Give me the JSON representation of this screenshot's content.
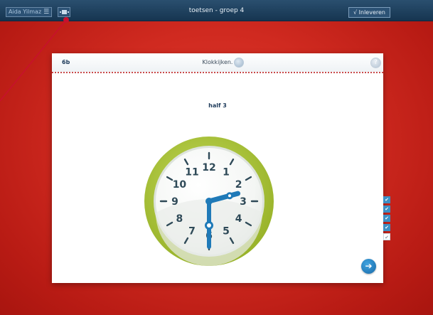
{
  "topbar": {
    "user_name": "Aida Yilmaz",
    "menu_icon": "menu-icon",
    "screen_icon": "screen-icon",
    "window_title": "toetsen - groep 4",
    "submit_label": "√ Inleveren"
  },
  "exercise": {
    "code": "6b",
    "title": "Klokkijken.",
    "audio_icon": "speaker-icon",
    "help_icon": "help-icon",
    "question": "half 3"
  },
  "clock": {
    "numbers": [
      "12",
      "1",
      "2",
      "3",
      "4",
      "5",
      "6",
      "7",
      "8",
      "9",
      "10",
      "11"
    ],
    "time_hours": 2,
    "time_minutes": 30,
    "rim_color": "#a8c43a",
    "hand_color": "#1f7ab8"
  },
  "progress": {
    "items": [
      "✔",
      "✔",
      "✔",
      "✔",
      "✔"
    ],
    "current_index": 4,
    "done_color": "#3d8fc4"
  },
  "navigation": {
    "next_icon": "arrow-right-icon",
    "next_glyph": "➔"
  },
  "colors": {
    "background": "#d02a20",
    "topbar": "#1e4060",
    "pointer_line": "#c8102e"
  }
}
